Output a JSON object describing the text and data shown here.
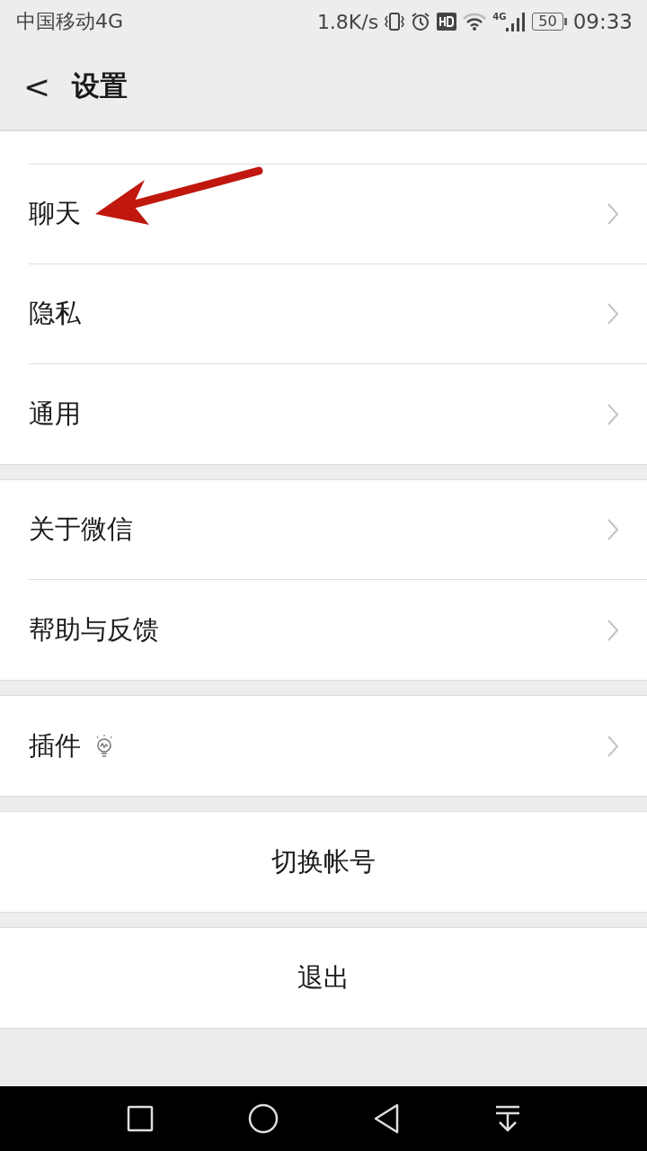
{
  "status_bar": {
    "carrier": "中国移动4G",
    "speed": "1.8K/s",
    "network": "4G",
    "battery": "50",
    "time": "09:33"
  },
  "header": {
    "back": "<",
    "title": "设置"
  },
  "groups": [
    {
      "items": [
        {
          "kind": "nav",
          "label": "聊天"
        },
        {
          "kind": "nav",
          "label": "隐私"
        },
        {
          "kind": "nav",
          "label": "通用"
        }
      ]
    },
    {
      "items": [
        {
          "kind": "nav",
          "label": "关于微信"
        },
        {
          "kind": "nav",
          "label": "帮助与反馈"
        }
      ]
    },
    {
      "items": [
        {
          "kind": "nav_icon",
          "label": "插件"
        }
      ]
    },
    {
      "items": [
        {
          "kind": "action",
          "label": "切换帐号"
        }
      ]
    },
    {
      "items": [
        {
          "kind": "action",
          "label": "退出"
        }
      ]
    }
  ]
}
